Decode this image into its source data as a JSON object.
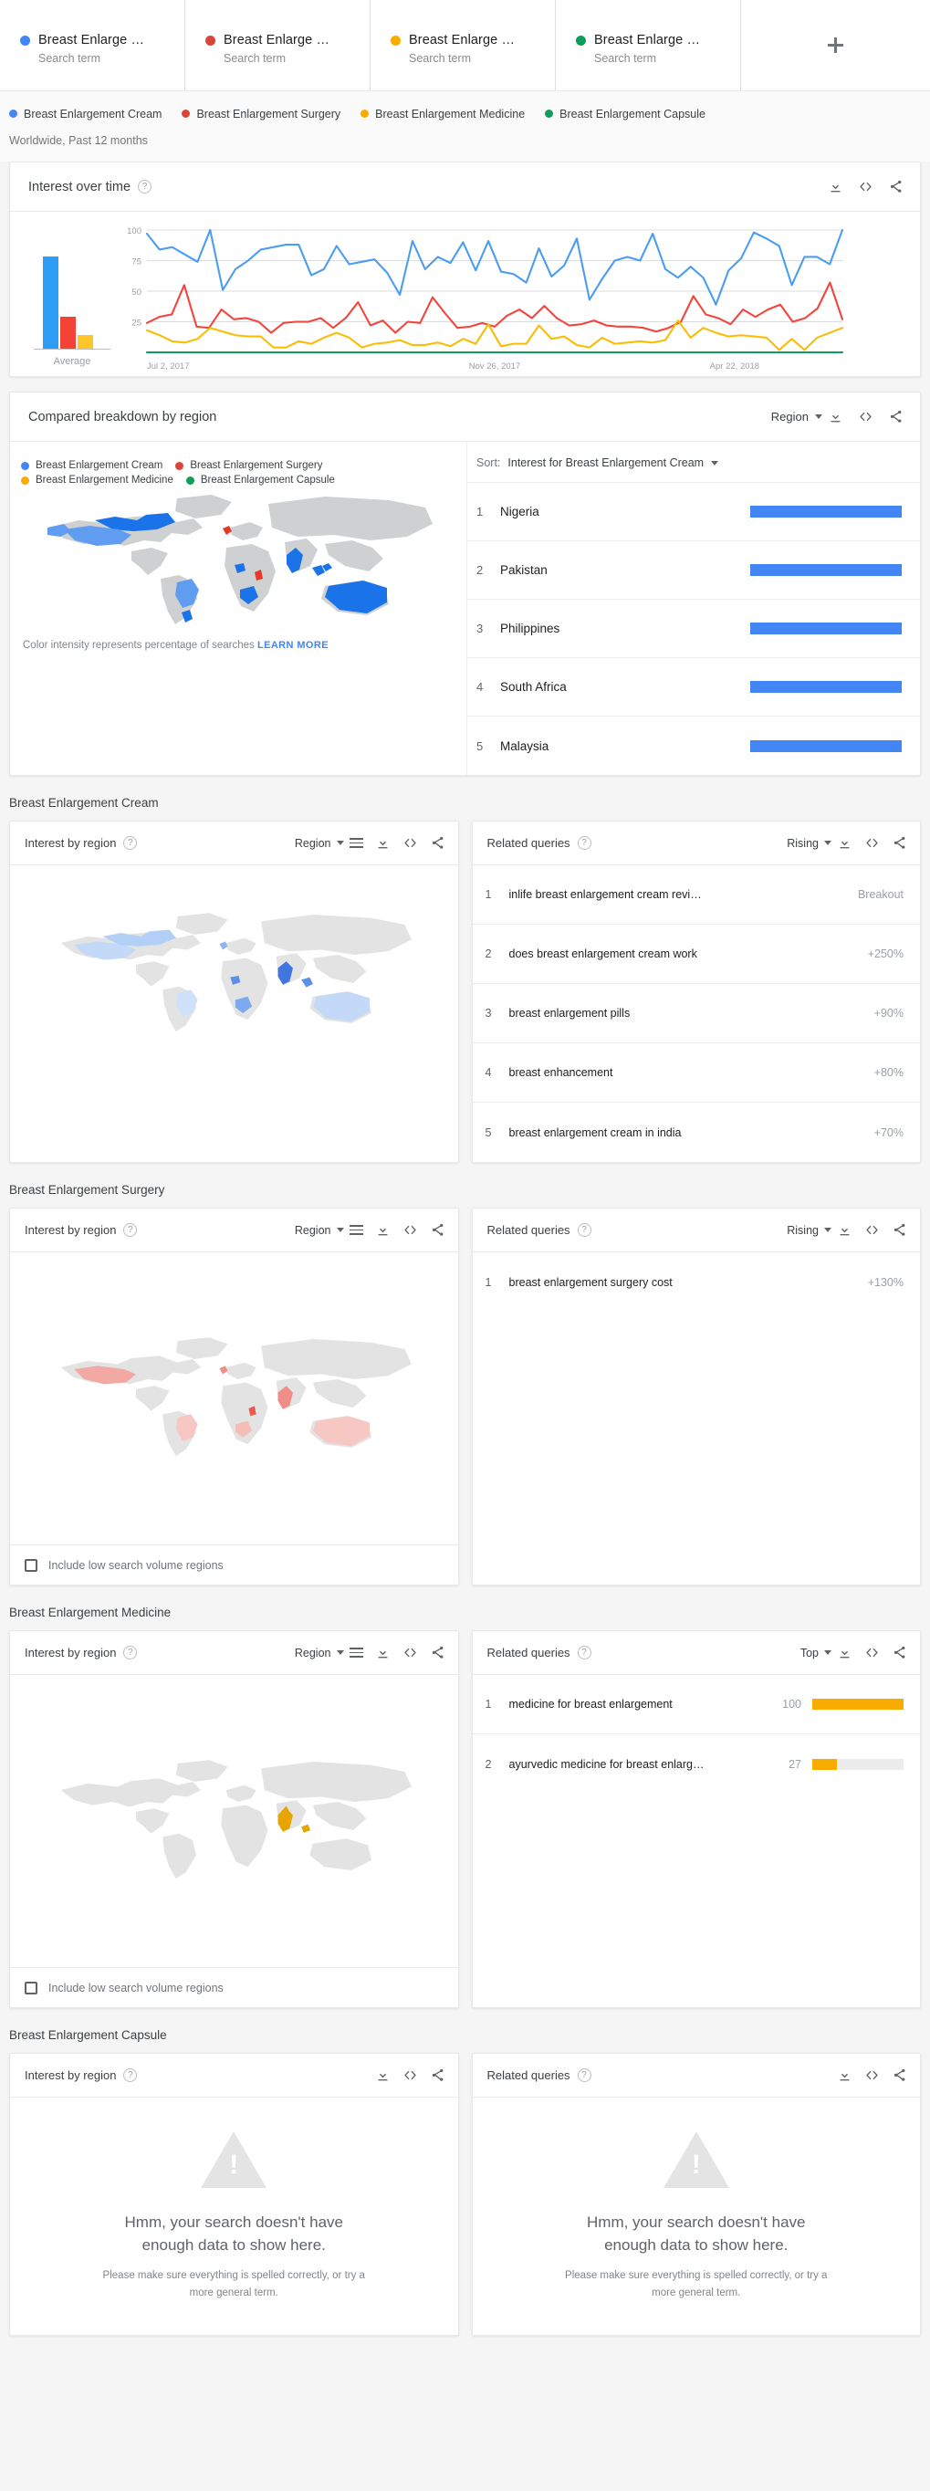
{
  "tabs": [
    {
      "title": "Breast Enlarge  …",
      "subtitle": "Search term",
      "color": "#4285f4"
    },
    {
      "title": "Breast Enlarge  …",
      "subtitle": "Search term",
      "color": "#db4437"
    },
    {
      "title": "Breast Enlarge  …",
      "subtitle": "Search term",
      "color": "#f9ab00"
    },
    {
      "title": "Breast Enlarge  …",
      "subtitle": "Search term",
      "color": "#0f9d58"
    }
  ],
  "add_tab_label": "+",
  "legend": [
    {
      "label": "Breast Enlargement Cream",
      "color": "#4285f4"
    },
    {
      "label": "Breast Enlargement Surgery",
      "color": "#db4437"
    },
    {
      "label": "Breast Enlargement Medicine",
      "color": "#f9ab00"
    },
    {
      "label": "Breast Enlargement Capsule",
      "color": "#0f9d58"
    }
  ],
  "scope": "Worldwide, Past 12 months",
  "interest_over_time": {
    "title": "Interest over time",
    "help": "?",
    "average_label": "Average"
  },
  "breakdown": {
    "title": "Compared breakdown by region",
    "help": "?",
    "region_dropdown": "Region",
    "sort_label": "Sort:",
    "sort_value": "Interest for Breast Enlargement Cream",
    "map_note": "Color intensity represents percentage of searches",
    "learn_more": "LEARN MORE",
    "rows": [
      {
        "rank": "1",
        "name": "Nigeria",
        "pct": 100
      },
      {
        "rank": "2",
        "name": "Pakistan",
        "pct": 100
      },
      {
        "rank": "3",
        "name": "Philippines",
        "pct": 100
      },
      {
        "rank": "4",
        "name": "South Africa",
        "pct": 100
      },
      {
        "rank": "5",
        "name": "Malaysia",
        "pct": 100
      }
    ]
  },
  "sections": [
    {
      "heading": "Breast Enlargement Cream",
      "region_panel": {
        "title": "Interest by region",
        "help": "?",
        "dropdown": "Region",
        "show_low_volume_checkbox": false,
        "low_volume_label": "Include low search volume regions",
        "map_color": "#4285f4",
        "map_style": "cream"
      },
      "queries_panel": {
        "title": "Related queries",
        "help": "?",
        "dropdown": "Rising",
        "empty": false,
        "rows": [
          {
            "rank": "1",
            "text": "inlife breast enlargement cream revi…",
            "value": "Breakout",
            "bar": null
          },
          {
            "rank": "2",
            "text": "does breast enlargement cream work",
            "value": "+250%",
            "bar": null
          },
          {
            "rank": "3",
            "text": "breast enlargement pills",
            "value": "+90%",
            "bar": null
          },
          {
            "rank": "4",
            "text": "breast enhancement",
            "value": "+80%",
            "bar": null
          },
          {
            "rank": "5",
            "text": "breast enlargement cream in india",
            "value": "+70%",
            "bar": null
          }
        ]
      }
    },
    {
      "heading": "Breast Enlargement Surgery",
      "region_panel": {
        "title": "Interest by region",
        "help": "?",
        "dropdown": "Region",
        "show_low_volume_checkbox": true,
        "low_volume_label": "Include low search volume regions",
        "map_color": "#db4437",
        "map_style": "surgery"
      },
      "queries_panel": {
        "title": "Related queries",
        "help": "?",
        "dropdown": "Rising",
        "empty": false,
        "rows": [
          {
            "rank": "1",
            "text": "breast enlargement surgery cost",
            "value": "+130%",
            "bar": null
          }
        ]
      }
    },
    {
      "heading": "Breast Enlargement Medicine",
      "region_panel": {
        "title": "Interest by region",
        "help": "?",
        "dropdown": "Region",
        "show_low_volume_checkbox": true,
        "low_volume_label": "Include low search volume regions",
        "map_color": "#f9ab00",
        "map_style": "medicine"
      },
      "queries_panel": {
        "title": "Related queries",
        "help": "?",
        "dropdown": "Top",
        "empty": false,
        "rows": [
          {
            "rank": "1",
            "text": "medicine for breast enlargement",
            "value": "100",
            "bar": 100
          },
          {
            "rank": "2",
            "text": "ayurvedic medicine for breast enlarg…",
            "value": "27",
            "bar": 27
          }
        ]
      }
    },
    {
      "heading": "Breast Enlargement Capsule",
      "region_panel": {
        "title": "Interest by region",
        "help": "?",
        "dropdown": null,
        "show_low_volume_checkbox": false,
        "empty": true,
        "empty_title": "Hmm, your search doesn't have enough data to show here.",
        "empty_sub": "Please make sure everything is spelled correctly, or try a more general term."
      },
      "queries_panel": {
        "title": "Related queries",
        "help": "?",
        "dropdown": null,
        "empty": true,
        "empty_title": "Hmm, your search doesn't have enough data to show here.",
        "empty_sub": "Please make sure everything is spelled correctly, or try a more general term.",
        "rows": []
      }
    }
  ],
  "chart_data": {
    "type": "line",
    "title": "Interest over time",
    "xlabel": "",
    "ylabel": "",
    "ylim": [
      0,
      100
    ],
    "yticks": [
      25,
      50,
      75,
      100
    ],
    "grid": true,
    "legend_position": "top",
    "xtick_labels": [
      "Jul 2, 2017",
      "Nov 26, 2017",
      "Apr 22, 2018"
    ],
    "xtick_positions": [
      0,
      0.5,
      0.845
    ],
    "average_bars": {
      "label": "Average",
      "categories": [
        "Breast Enlargement Cream",
        "Breast Enlargement Surgery",
        "Breast Enlargement Medicine",
        "Breast Enlargement Capsule"
      ],
      "values": [
        75,
        26,
        11,
        0
      ],
      "colors": [
        "#2d9cf5",
        "#f44336",
        "#ffc629",
        "#0f9d58"
      ]
    },
    "series": [
      {
        "name": "Breast Enlargement Cream",
        "color": "#4a9df0",
        "values": [
          97,
          84,
          86,
          80,
          74,
          100,
          51,
          68,
          75,
          84,
          86,
          88,
          88,
          63,
          68,
          87,
          72,
          74,
          76,
          65,
          47,
          91,
          68,
          78,
          73,
          90,
          67,
          91,
          66,
          64,
          57,
          85,
          62,
          71,
          93,
          43,
          60,
          75,
          78,
          75,
          97,
          68,
          61,
          70,
          61,
          39,
          67,
          77,
          98,
          93,
          87,
          55,
          78,
          78,
          72,
          100
        ]
      },
      {
        "name": "Breast Enlargement Surgery",
        "color": "#f2453d",
        "values": [
          24,
          29,
          31,
          55,
          21,
          20,
          35,
          27,
          28,
          25,
          16,
          24,
          25,
          25,
          28,
          20,
          28,
          41,
          22,
          26,
          16,
          25,
          24,
          45,
          32,
          20,
          21,
          24,
          21,
          30,
          35,
          28,
          38,
          28,
          22,
          23,
          26,
          22,
          21,
          21,
          20,
          17,
          20,
          25,
          46,
          31,
          28,
          23,
          35,
          29,
          35,
          39,
          25,
          28,
          36,
          57,
          27
        ]
      },
      {
        "name": "Breast Enlargement Medicine",
        "color": "#fbbc04",
        "values": [
          18,
          14,
          9,
          8,
          11,
          20,
          17,
          14,
          13,
          13,
          4,
          4,
          9,
          7,
          12,
          16,
          12,
          4,
          7,
          8,
          10,
          6,
          6,
          8,
          5,
          11,
          7,
          23,
          5,
          7,
          7,
          22,
          11,
          13,
          6,
          4,
          12,
          7,
          8,
          9,
          8,
          10,
          26,
          12,
          20,
          16,
          13,
          14,
          13,
          12,
          2,
          11,
          2,
          12,
          16,
          20
        ]
      },
      {
        "name": "Breast Enlargement Capsule",
        "color": "#0f9d58",
        "values": [
          0,
          0,
          0,
          0,
          0,
          0,
          0,
          0,
          0,
          0,
          0,
          0,
          0,
          0,
          0,
          0,
          0,
          0,
          0,
          0,
          0,
          0,
          0,
          0,
          0,
          0,
          0,
          0,
          0,
          0,
          0,
          0,
          0,
          0,
          0,
          0,
          0,
          0,
          0,
          0,
          0,
          0,
          0,
          0,
          0,
          0,
          0,
          0,
          0,
          0,
          0,
          0,
          0,
          0,
          0,
          0
        ]
      }
    ]
  }
}
